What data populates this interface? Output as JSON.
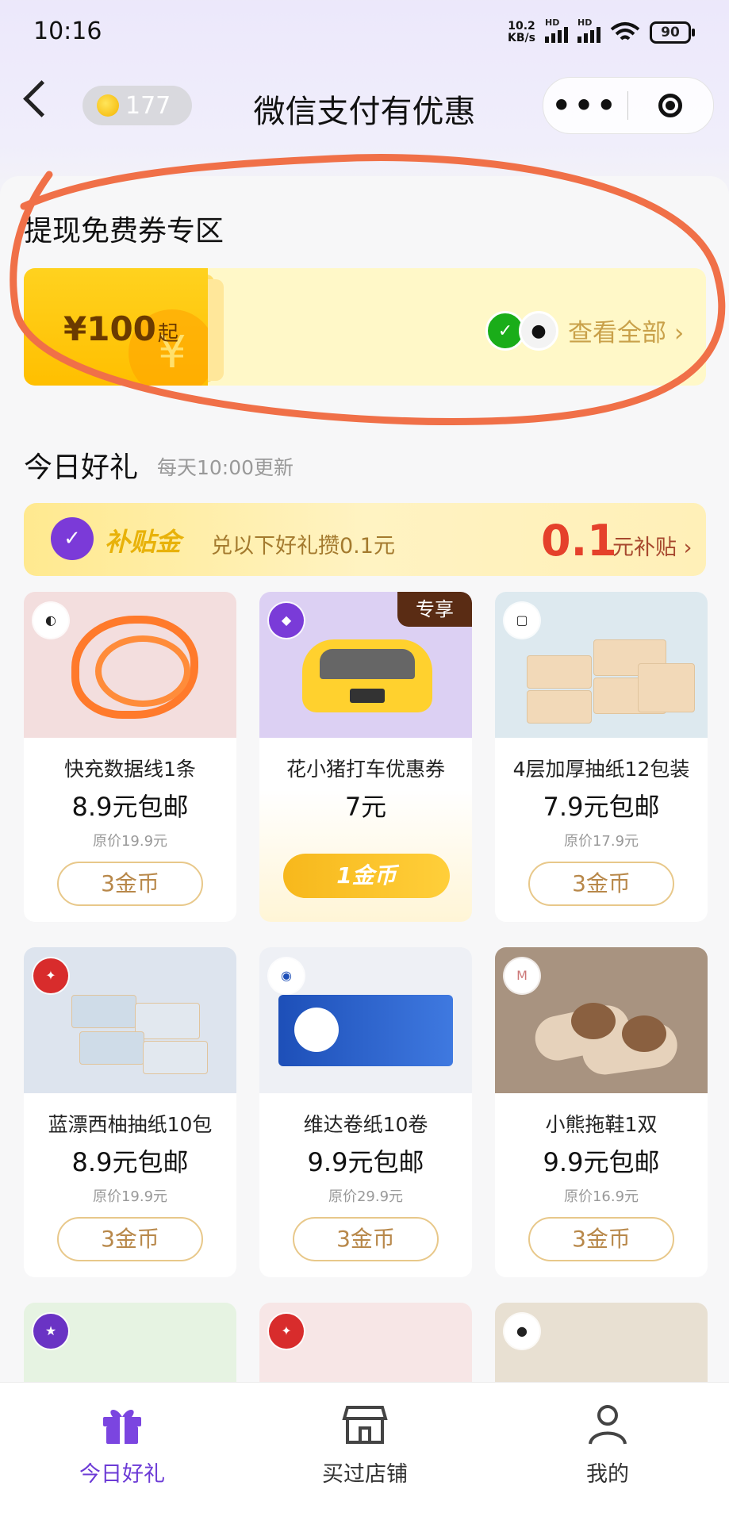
{
  "status_bar": {
    "time": "10:16",
    "net_speed_value": "10.2",
    "net_speed_unit": "KB/s",
    "hd_label": "HD",
    "battery": "90"
  },
  "nav": {
    "coin_count": "177",
    "title": "微信支付有优惠"
  },
  "cashout": {
    "section_title": "提现免费券专区",
    "voucher_amount": "¥100",
    "voucher_suffix": "起",
    "voucher_watermark": "¥",
    "view_all": "查看全部 ›"
  },
  "gifts": {
    "title": "今日好礼",
    "subtitle": "每天10:00更新"
  },
  "subsidy": {
    "label": "补贴金",
    "description": "兑以下好礼攒0.1元",
    "amount": "0.1",
    "unit": "元补贴 ›"
  },
  "products": [
    {
      "name": "快充数据线1条",
      "price": "8.9元包邮",
      "original": "原价19.9元",
      "button": "3金币"
    },
    {
      "name": "花小猪打车优惠券",
      "price": "7元",
      "tag": "专享",
      "button": "1金币"
    },
    {
      "name": "4层加厚抽纸12包装",
      "price": "7.9元包邮",
      "original": "原价17.9元",
      "button": "3金币"
    },
    {
      "name": "蓝漂西柚抽纸10包",
      "price": "8.9元包邮",
      "original": "原价19.9元",
      "button": "3金币"
    },
    {
      "name": "维达卷纸10卷",
      "price": "9.9元包邮",
      "original": "原价29.9元",
      "button": "3金币"
    },
    {
      "name": "小熊拖鞋1双",
      "price": "9.9元包邮",
      "original": "原价16.9元",
      "button": "3金币"
    }
  ],
  "tabs": [
    {
      "label": "今日好礼",
      "icon": "gift-icon",
      "active": true
    },
    {
      "label": "买过店铺",
      "icon": "store-icon",
      "active": false
    },
    {
      "label": "我的",
      "icon": "user-icon",
      "active": false
    }
  ],
  "colors": {
    "accent": "#6c3bd6",
    "gold": "#ffc400",
    "annotation": "#f07048",
    "price_red": "#e5412b"
  }
}
